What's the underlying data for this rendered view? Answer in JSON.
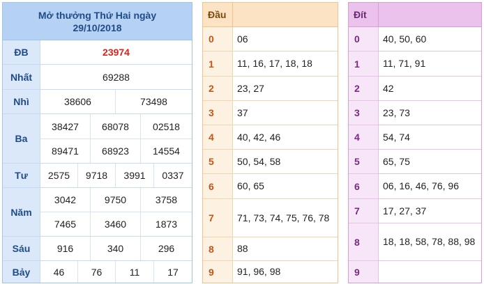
{
  "results": {
    "title_line1": "Mở thưởng Thứ Hai ngày",
    "title_line2": "29/10/2018",
    "rows": [
      {
        "label": "ĐB",
        "values": [
          "23974"
        ]
      },
      {
        "label": "Nhất",
        "values": [
          "69288"
        ]
      },
      {
        "label": "Nhì",
        "values": [
          "38606",
          "73498"
        ]
      },
      {
        "label": "Ba",
        "values": [
          "38427",
          "68078",
          "02518",
          "89471",
          "68923",
          "14554"
        ]
      },
      {
        "label": "Tư",
        "values": [
          "2575",
          "9718",
          "3991",
          "0337"
        ]
      },
      {
        "label": "Năm",
        "values": [
          "3042",
          "9750",
          "3758",
          "7465",
          "3460",
          "1873"
        ]
      },
      {
        "label": "Sáu",
        "values": [
          "916",
          "340",
          "296"
        ]
      },
      {
        "label": "Bảy",
        "values": [
          "46",
          "76",
          "11",
          "17"
        ]
      }
    ]
  },
  "dau": {
    "header": "Đầu",
    "rows": [
      {
        "key": "0",
        "value": "06"
      },
      {
        "key": "1",
        "value": "11, 16, 17, 18, 18"
      },
      {
        "key": "2",
        "value": "23, 27"
      },
      {
        "key": "3",
        "value": "37"
      },
      {
        "key": "4",
        "value": "40, 42, 46"
      },
      {
        "key": "5",
        "value": "50, 54, 58"
      },
      {
        "key": "6",
        "value": "60, 65"
      },
      {
        "key": "7",
        "value": "71, 73, 74, 75, 76, 78"
      },
      {
        "key": "8",
        "value": "88"
      },
      {
        "key": "9",
        "value": "91, 96, 98"
      }
    ]
  },
  "dit": {
    "header": "Đít",
    "rows": [
      {
        "key": "0",
        "value": "40, 50, 60"
      },
      {
        "key": "1",
        "value": "11, 71, 91"
      },
      {
        "key": "2",
        "value": "42"
      },
      {
        "key": "3",
        "value": "23, 73"
      },
      {
        "key": "4",
        "value": "54, 74"
      },
      {
        "key": "5",
        "value": "65, 75"
      },
      {
        "key": "6",
        "value": "06, 16, 46, 76, 96"
      },
      {
        "key": "7",
        "value": "17, 27, 37"
      },
      {
        "key": "8",
        "value": "18, 18, 58, 78, 88, 98"
      },
      {
        "key": "9",
        "value": ""
      }
    ]
  },
  "colors": {
    "special_prize": "#e0201b",
    "results_header": "#b5d1f4",
    "dau_header": "#fbe3c3",
    "dit_header": "#ebc2ec"
  }
}
